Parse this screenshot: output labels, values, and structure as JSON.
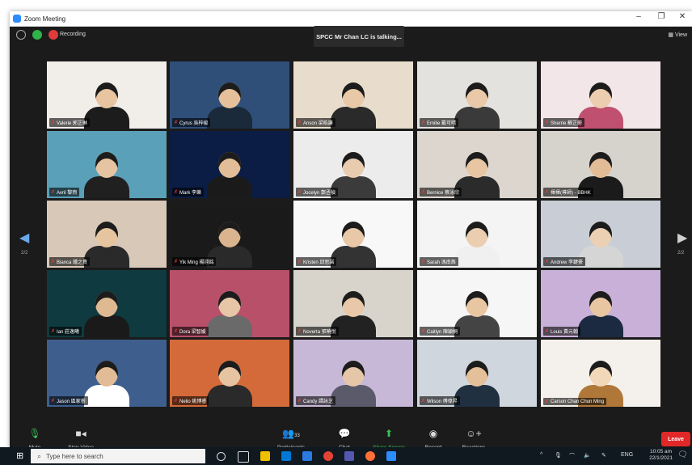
{
  "window": {
    "title": "Zoom Meeting"
  },
  "topbar": {
    "recording_label": "Recording",
    "speaker": "SPCC Mr Chan LC is talking...",
    "view_label": "View"
  },
  "nav": {
    "left_arrow": "◀",
    "right_arrow": "▶",
    "page_left": "2/2",
    "page_right": "2/2"
  },
  "participants": [
    {
      "name": "Valerie 郭芷琳",
      "bg": "#f1eeea",
      "skin": "#e8c4a0",
      "shirt": "#1c1c1c"
    },
    {
      "name": "Cyrus 吳梓峻",
      "bg": "#2f4f78",
      "skin": "#e6c09a",
      "shirt": "#1a2a3a"
    },
    {
      "name": "Anson 梁皓謙",
      "bg": "#e8ddcc",
      "skin": "#e8c8a6",
      "shirt": "#2a2a2a"
    },
    {
      "name": "Emilie 戴可晴",
      "bg": "#e4e2de",
      "skin": "#e9c9a8",
      "shirt": "#3a3a3a"
    },
    {
      "name": "Sherrie 蘇芷蔚",
      "bg": "#f2e6e8",
      "skin": "#eccdaf",
      "shirt": "#c05070"
    },
    {
      "name": "Avril 黎煦",
      "bg": "#5aa0b8",
      "skin": "#e6c4a2",
      "shirt": "#202020"
    },
    {
      "name": "Mark 李樂",
      "bg": "#0b1d44",
      "skin": "#e3bd98",
      "shirt": "#1a1a1a"
    },
    {
      "name": "Jocelyn 鄭丞楨",
      "bg": "#ececec",
      "skin": "#e9cbb0",
      "shirt": "#3b3b3b"
    },
    {
      "name": "Bernice 蔡泳欣",
      "bg": "#dcd6cf",
      "skin": "#e8c6a4",
      "shirt": "#2b2b2b"
    },
    {
      "name": "揮揮(導師) - BBHK",
      "bg": "#d6d2cc",
      "skin": "#e2bc96",
      "shirt": "#1b1b1b"
    },
    {
      "name": "Bianca 鍾之貴",
      "bg": "#d8c8b8",
      "skin": "#e6c4a0",
      "shirt": "#2a2a2a"
    },
    {
      "name": "Yik Ming 楊翊銘",
      "bg": "#1a1a1a",
      "skin": "#d9b48e",
      "shirt": "#2a2a2a"
    },
    {
      "name": "Kristen 邱思諾",
      "bg": "#f8f8f8",
      "skin": "#e9c8a8",
      "shirt": "#333333"
    },
    {
      "name": "Sarah 馮南茜",
      "bg": "#f4f4f4",
      "skin": "#ebcdb0",
      "shirt": "#f0f0f0"
    },
    {
      "name": "Andrew 李鍵豪",
      "bg": "#c9ced6",
      "skin": "#ecd0b4",
      "shirt": "#d5d5d5"
    },
    {
      "name": "Ian 莊逸曦",
      "bg": "#0f3a40",
      "skin": "#dfb992",
      "shirt": "#1a1a1a"
    },
    {
      "name": "Dora 梁智媛",
      "bg": "#b9506a",
      "skin": "#e6c6a6",
      "shirt": "#6a6a6a"
    },
    {
      "name": "Noverta 張曉悅",
      "bg": "#d8d4cc",
      "skin": "#e8c8a8",
      "shirt": "#222222"
    },
    {
      "name": "Caitlyn 陳穎桐",
      "bg": "#f6f6f6",
      "skin": "#e8c6a2",
      "shirt": "#444444"
    },
    {
      "name": "Louis 黃元翰",
      "bg": "#c8b0d8",
      "skin": "#e8c6a2",
      "shirt": "#1b2a40"
    },
    {
      "name": "Jason 區家睿",
      "bg": "#3e5f8e",
      "skin": "#e2bc96",
      "shirt": "#ffffff"
    },
    {
      "name": "Nelio 姚博睿",
      "bg": "#d46a3a",
      "skin": "#e6c4a2",
      "shirt": "#2a2a2a"
    },
    {
      "name": "Candy 譚詠芝",
      "bg": "#c8b8d8",
      "skin": "#e6c6a8",
      "shirt": "#5a5a6a"
    },
    {
      "name": "Wilson 傅偉昇",
      "bg": "#cfd6de",
      "skin": "#e3bf9a",
      "shirt": "#203040"
    },
    {
      "name": "Carson Chan Chun Ming",
      "bg": "#f4f1ec",
      "skin": "#f0d8b8",
      "shirt": "#b07838"
    }
  ],
  "toolbar": {
    "mute": "Mute",
    "stop_video": "Stop Video",
    "participants": "Participants",
    "participants_count": "33",
    "chat": "Chat",
    "share_screen": "Share Screen",
    "record": "Record",
    "reactions": "Reactions",
    "leave": "Leave"
  },
  "taskbar": {
    "search_placeholder": "Type here to search",
    "lang": "ENG",
    "time": "10:05 am",
    "date": "22/1/2021"
  }
}
